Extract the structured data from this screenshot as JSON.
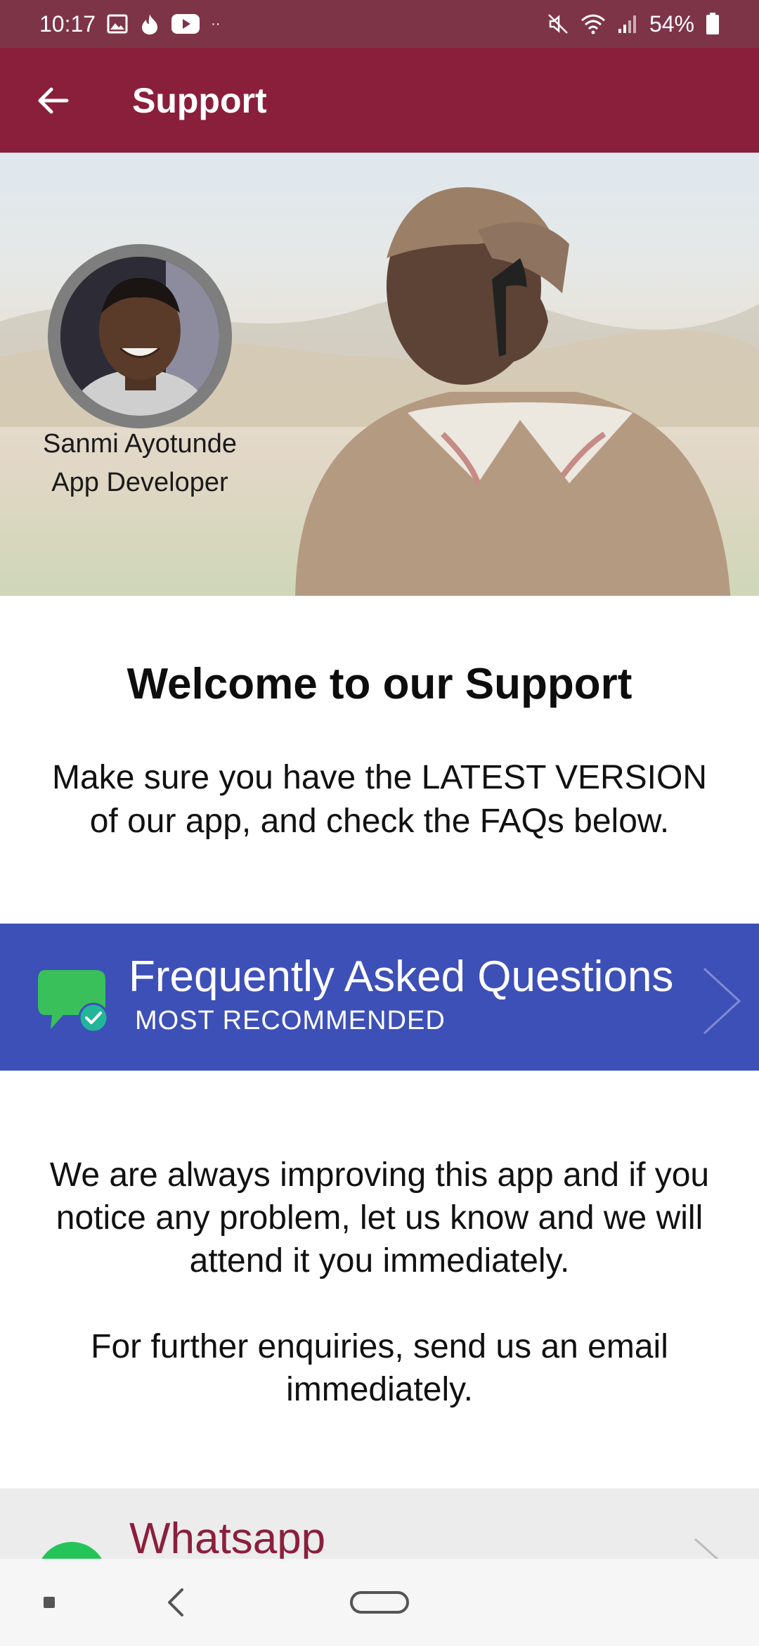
{
  "status_bar": {
    "time": "10:17",
    "more_indicator": "··",
    "battery": "54%",
    "left_icons": [
      "gallery-icon",
      "tinder-flame-icon",
      "youtube-icon"
    ],
    "right_icons": [
      "mute-icon",
      "wifi-icon",
      "signal-icon",
      "battery-icon"
    ]
  },
  "app_bar": {
    "title": "Support",
    "back_icon": "arrow-back-icon",
    "color": "#8a1f3c"
  },
  "hero": {
    "developer_name": "Sanmi Ayotunde",
    "developer_role": "App Developer"
  },
  "welcome": {
    "title": "Welcome to our Support",
    "line1": "Make sure you have the LATEST VERSION",
    "line2": "of our app, and check the FAQs below."
  },
  "faq": {
    "title": "Frequently Asked Questions",
    "subtitle": "MOST RECOMMENDED",
    "color": "#3d50b7",
    "icon": "chat-bubble-check-icon"
  },
  "info": {
    "improve_line1": "We are always improving this app and if you",
    "improve_line2": "notice any problem, let us know and we will",
    "improve_line3": "attend it you immediately.",
    "enquiry_line1": "For further enquiries, send us an email",
    "enquiry_line2": "immediately."
  },
  "whatsapp": {
    "title": "Whatsapp",
    "icon": "whatsapp-icon"
  },
  "nav_bar": {
    "icons": [
      "recent-apps-icon",
      "nav-back-icon",
      "home-pill-icon"
    ]
  }
}
